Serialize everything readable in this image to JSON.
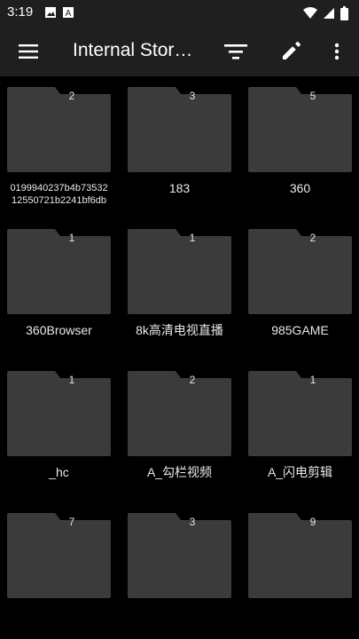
{
  "status": {
    "time": "3:19",
    "left_icons": [
      "image-icon",
      "a-icon"
    ],
    "right_icons": [
      "wifi-icon",
      "signal-icon",
      "battery-icon"
    ]
  },
  "appbar": {
    "title": "Internal Stor…",
    "actions": [
      "sort-icon",
      "edit-icon",
      "more-vert-icon"
    ]
  },
  "folders": [
    {
      "name": "0199940237b4b73532\n12550721b2241bf6db",
      "count": "2"
    },
    {
      "name": "183",
      "count": "3"
    },
    {
      "name": "360",
      "count": "5"
    },
    {
      "name": "360Browser",
      "count": "1"
    },
    {
      "name": "8k高清电视直播",
      "count": "1"
    },
    {
      "name": "985GAME",
      "count": "2"
    },
    {
      "name": "_hc",
      "count": "1"
    },
    {
      "name": "A_勾栏视频",
      "count": "2"
    },
    {
      "name": "A_闪电剪辑",
      "count": "1"
    },
    {
      "name": "",
      "count": "7"
    },
    {
      "name": "",
      "count": "3"
    },
    {
      "name": "",
      "count": "9"
    }
  ],
  "colors": {
    "background": "#000000",
    "bar": "#1f1f1f",
    "folder": "#3b3b3b"
  }
}
